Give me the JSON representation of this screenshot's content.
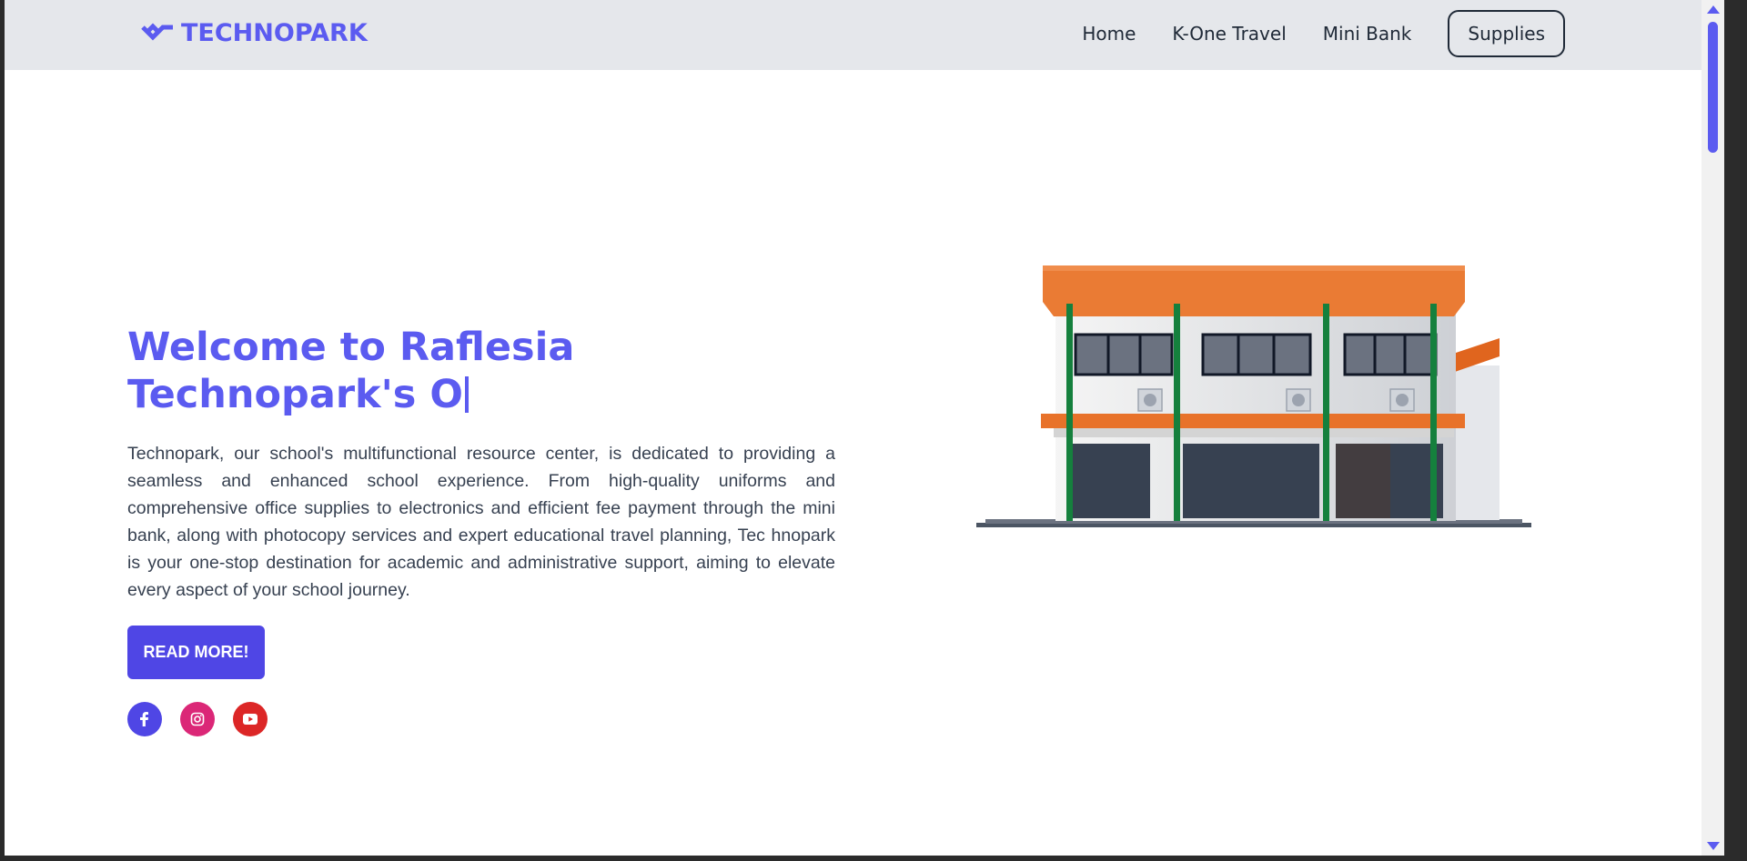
{
  "navbar": {
    "brand": "TECHNOPARK",
    "links": [
      {
        "label": "Home"
      },
      {
        "label": "K-One Travel"
      },
      {
        "label": "Mini Bank"
      }
    ],
    "cta_label": "Supplies"
  },
  "hero": {
    "title_line1": "Welcome to Raflesia",
    "title_line2": "Technopark's O",
    "description": "Technopark, our school's multifunctional resource center, is dedicated to providing a seamless and enhanced school experience. From high-quality uniforms and comprehensive office supplies to electronics and efficient fee payment through the mini bank, along with photocopy services and expert educational travel planning, Tec hnopark is your one-stop destination for academic and administrative support, aiming to elevate every aspect of your school journey.",
    "button_label": "READ MORE!"
  },
  "socials": [
    {
      "icon": "facebook-icon",
      "color": "#4f46e5"
    },
    {
      "icon": "instagram-icon",
      "color": "#db2777"
    },
    {
      "icon": "youtube-icon",
      "color": "#dc2626"
    }
  ],
  "colors": {
    "accent": "#5b5bf0",
    "button": "#4f46e5",
    "navbar_bg": "#e5e7eb",
    "text": "#374151"
  }
}
